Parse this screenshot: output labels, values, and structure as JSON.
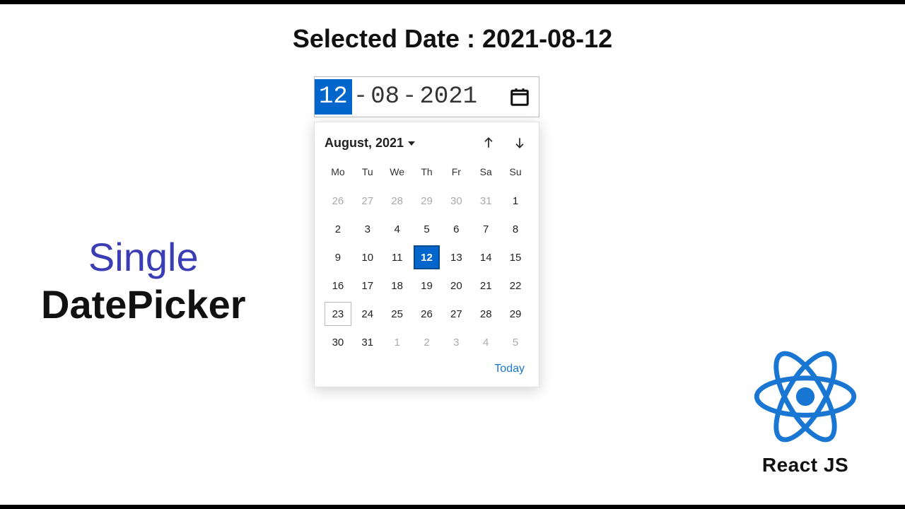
{
  "header": {
    "text": "Selected Date : 2021-08-12"
  },
  "side": {
    "line1": "Single",
    "line2": "DatePicker"
  },
  "input": {
    "day": "12",
    "month": "08",
    "year": "2021",
    "separator": "-"
  },
  "calendar": {
    "title": "August, 2021",
    "weekdays": [
      "Mo",
      "Tu",
      "We",
      "Th",
      "Fr",
      "Sa",
      "Su"
    ],
    "days": [
      {
        "n": "26",
        "muted": true
      },
      {
        "n": "27",
        "muted": true
      },
      {
        "n": "28",
        "muted": true
      },
      {
        "n": "29",
        "muted": true
      },
      {
        "n": "30",
        "muted": true
      },
      {
        "n": "31",
        "muted": true
      },
      {
        "n": "1"
      },
      {
        "n": "2"
      },
      {
        "n": "3"
      },
      {
        "n": "4"
      },
      {
        "n": "5"
      },
      {
        "n": "6"
      },
      {
        "n": "7"
      },
      {
        "n": "8"
      },
      {
        "n": "9"
      },
      {
        "n": "10"
      },
      {
        "n": "11"
      },
      {
        "n": "12",
        "selected": true
      },
      {
        "n": "13"
      },
      {
        "n": "14"
      },
      {
        "n": "15"
      },
      {
        "n": "16"
      },
      {
        "n": "17"
      },
      {
        "n": "18"
      },
      {
        "n": "19"
      },
      {
        "n": "20"
      },
      {
        "n": "21"
      },
      {
        "n": "22"
      },
      {
        "n": "23",
        "today": true
      },
      {
        "n": "24"
      },
      {
        "n": "25"
      },
      {
        "n": "26"
      },
      {
        "n": "27"
      },
      {
        "n": "28"
      },
      {
        "n": "29"
      },
      {
        "n": "30"
      },
      {
        "n": "31"
      },
      {
        "n": "1",
        "muted": true
      },
      {
        "n": "2",
        "muted": true
      },
      {
        "n": "3",
        "muted": true
      },
      {
        "n": "4",
        "muted": true
      },
      {
        "n": "5",
        "muted": true
      }
    ],
    "today_label": "Today"
  },
  "logo": {
    "caption": "React JS"
  },
  "colors": {
    "accent": "#0066cc",
    "link": "#1976d2",
    "side_purple": "#3a3db4"
  }
}
